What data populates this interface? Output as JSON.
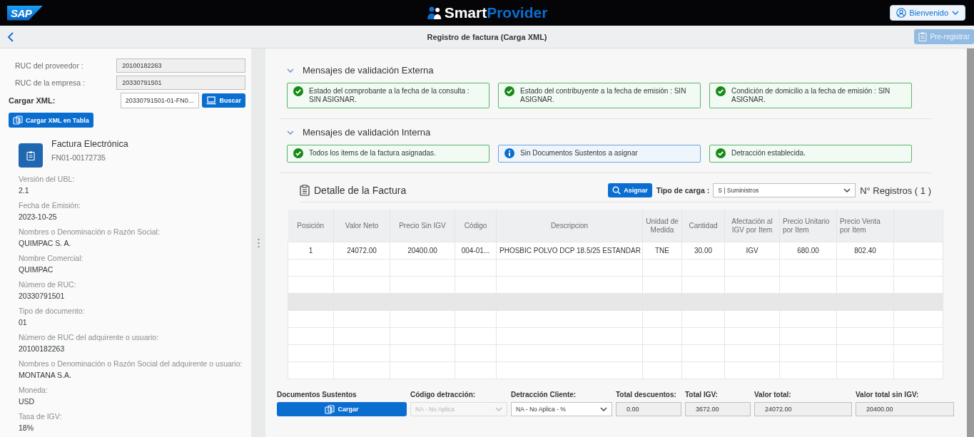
{
  "header": {
    "logo": "SAP",
    "brand": [
      "Smart",
      "Provider"
    ],
    "user_button": "Bienvenido"
  },
  "subheader": {
    "title": "Registro de factura (Carga XML)",
    "action": {
      "label": "Pre-registrar",
      "disabled": true
    }
  },
  "left_panel": {
    "fields": [
      {
        "label": "RUC del proveedor :",
        "value": "20100182263"
      },
      {
        "label": "RUC de la empresa :",
        "value": "20330791501"
      }
    ],
    "upload": {
      "label": "Cargar XML:",
      "file": "20330791501-01-FN0...",
      "browse_button": "Buscar",
      "load_button": "Cargar XML en Tabla"
    },
    "document": {
      "title": "Factura Electrónica",
      "number": "FN01-00172735"
    },
    "details": [
      {
        "label": "Versión del UBL:",
        "value": "2.1"
      },
      {
        "label": "Fecha de Emisión:",
        "value": "2023-10-25"
      },
      {
        "label": "Nombres o Denominación o Razón Social:",
        "value": "QUIMPAC S. A."
      },
      {
        "label": "Nombre Comercial:",
        "value": "QUIMPAC"
      },
      {
        "label": "Número de RUC:",
        "value": "20330791501"
      },
      {
        "label": "Tipo de documento:",
        "value": "01"
      },
      {
        "label": "Número de RUC del adquirente o usuario:",
        "value": "20100182263"
      },
      {
        "label": "Nombres o Denominación o Razón Social del adquirente o usuario:",
        "value": "MONTANA S.A."
      },
      {
        "label": "Moneda:",
        "value": "USD"
      },
      {
        "label": "Tasa de IGV:",
        "value": "18%"
      }
    ]
  },
  "validation_sections": [
    {
      "title": "Mensajes de validación Externa",
      "expanded": true,
      "messages": [
        {
          "kind": "success",
          "text": "Estado del comprobante a la fecha de la consulta : SIN ASIGNAR."
        },
        {
          "kind": "success",
          "text": "Estado del contribuyente a la fecha de emisión : SIN ASIGNAR."
        },
        {
          "kind": "success",
          "text": "Condición de domicilio a la fecha de emisión : SIN ASIGNAR."
        }
      ]
    },
    {
      "title": "Mensajes de validación Interna",
      "expanded": true,
      "messages": [
        {
          "kind": "success",
          "text": "Todos los items de la factura asignadas."
        },
        {
          "kind": "info",
          "text": "Sin Documentos Sustentos a asignar"
        },
        {
          "kind": "success",
          "text": "Detracción establecida."
        }
      ]
    }
  ],
  "invoice_detail": {
    "title": "Detalle de la Factura",
    "assign_button": "Asignar",
    "load_type_label": "Tipo de carga :",
    "load_type_value": "S | Suministros",
    "record_count": "N° Registros ( 1 )",
    "table": {
      "columns": [
        "Posición",
        "Valor Neto",
        "Precio Sin IGV",
        "Código",
        "Descripcion",
        "Unidad de Medida",
        "Cantidad",
        "Afectación al IGV por Item",
        "Precio Unitario por Item",
        "Precio Venta por Item"
      ],
      "rows": [
        [
          "1",
          "24072.00",
          "20400.00",
          "004-01...",
          "PHOSBIC POLVO DCP 18.5/25 ESTANDAR",
          "TNE",
          "30.00",
          "IGV",
          "680.00",
          "802.40"
        ]
      ]
    }
  },
  "footer": [
    {
      "kind": "button",
      "label": "Documentos Sustentos",
      "value": "Cargar"
    },
    {
      "kind": "select",
      "label": "Código detracción:",
      "value": "NA - No Aplica",
      "disabled": true
    },
    {
      "kind": "select",
      "label": "Detracción Cliente:",
      "value": "NA - No Aplica - %",
      "disabled": false
    },
    {
      "kind": "input",
      "label": "Total descuentos:",
      "value": "0.00"
    },
    {
      "kind": "input",
      "label": "Total IGV:",
      "value": "3672.00"
    },
    {
      "kind": "input",
      "label": "Valor total:",
      "value": "24072.00"
    },
    {
      "kind": "input",
      "label": "Valor total sin IGV:",
      "value": "20400.00"
    }
  ]
}
